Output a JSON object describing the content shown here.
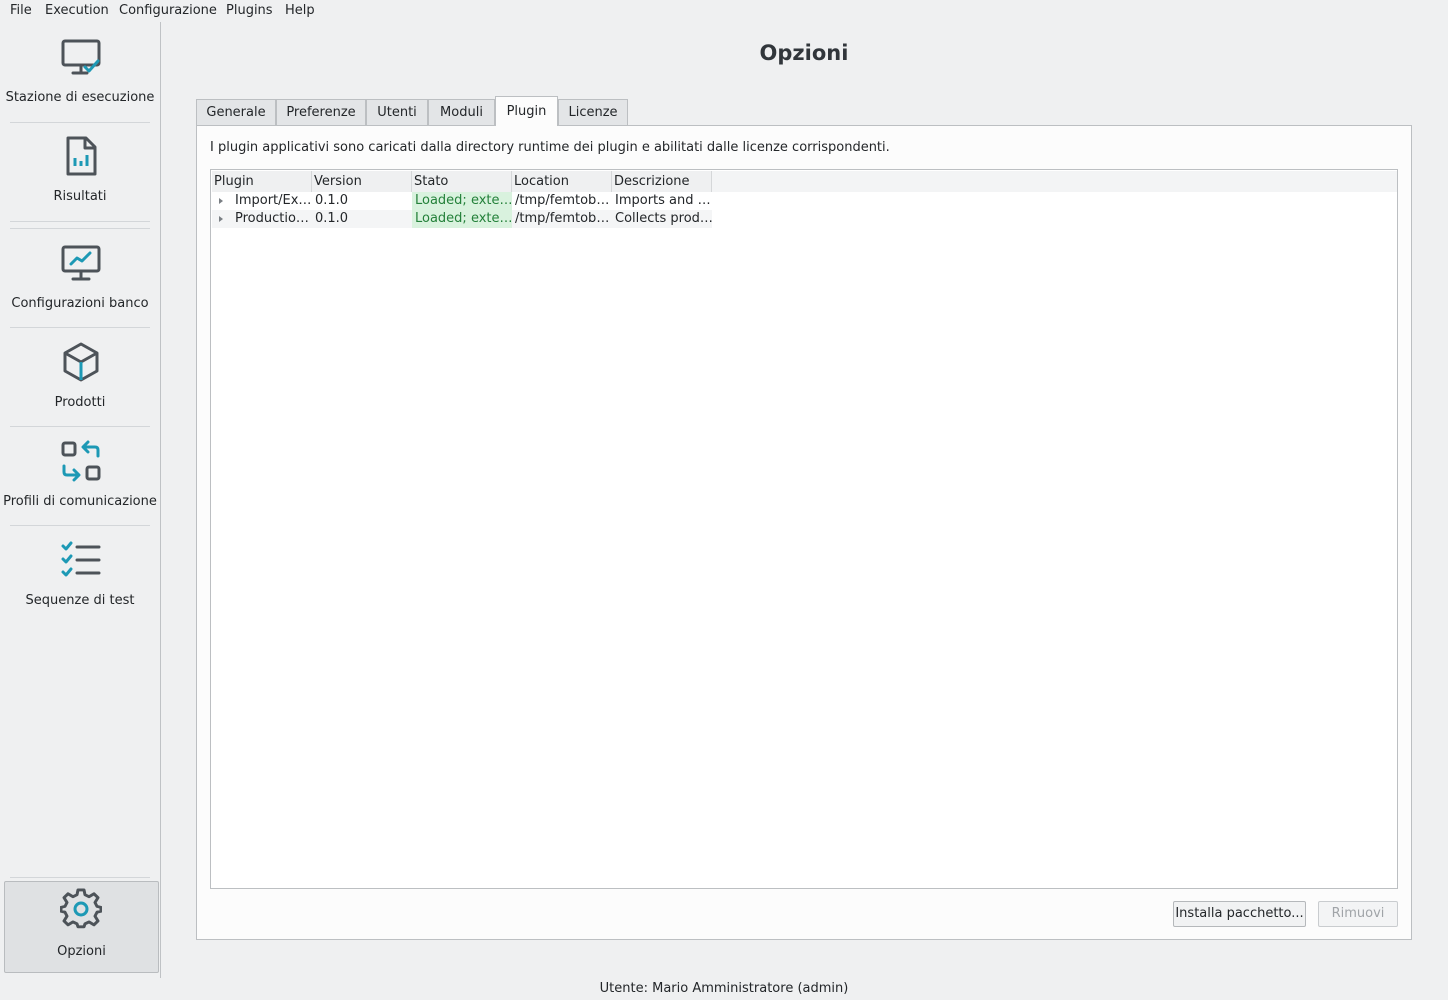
{
  "menu": {
    "file": "File",
    "execution": "Execution",
    "configurazione": "Configurazione",
    "plugins": "Plugins",
    "help": "Help"
  },
  "sidebar": {
    "items": [
      {
        "label": "Stazione di esecuzione",
        "icon": "monitor-check-icon"
      },
      {
        "label": "Risultati",
        "icon": "document-chart-icon"
      },
      {
        "label": "Configurazioni banco",
        "icon": "monitor-chart-icon"
      },
      {
        "label": "Prodotti",
        "icon": "box-icon"
      },
      {
        "label": "Profili di comunicazione",
        "icon": "swap-arrows-icon"
      },
      {
        "label": "Sequenze di test",
        "icon": "checklist-icon"
      }
    ],
    "options": {
      "label": "Opzioni",
      "icon": "gear-icon"
    }
  },
  "page": {
    "title": "Opzioni"
  },
  "tabs": [
    {
      "label": "Generale"
    },
    {
      "label": "Preferenze"
    },
    {
      "label": "Utenti"
    },
    {
      "label": "Moduli"
    },
    {
      "label": "Plugin"
    },
    {
      "label": "Licenze"
    }
  ],
  "active_tab": "Plugin",
  "plugin_panel": {
    "description": "I plugin applicativi sono caricati dalla directory runtime dei plugin e abilitati dalle licenze corrispondenti.",
    "columns": [
      "Plugin",
      "Version",
      "Stato",
      "Location",
      "Descrizione"
    ],
    "rows": [
      {
        "plugin": "Import/Ex…",
        "version": "0.1.0",
        "stato": "Loaded; exte…",
        "location": "/tmp/femtob…",
        "descrizione": "Imports and …"
      },
      {
        "plugin": "Productio…",
        "version": "0.1.0",
        "stato": "Loaded; exte…",
        "location": "/tmp/femtob…",
        "descrizione": "Collects prod…"
      }
    ],
    "install_button": "Installa pacchetto...",
    "remove_button": "Rimuovi"
  },
  "status_bar": {
    "text": "Utente: Mario Amministratore (admin)"
  },
  "colors": {
    "accent": "#1d99b5",
    "icon_gray": "#4d5359",
    "loaded_bg": "#d9f2de",
    "loaded_text": "#24813a"
  }
}
